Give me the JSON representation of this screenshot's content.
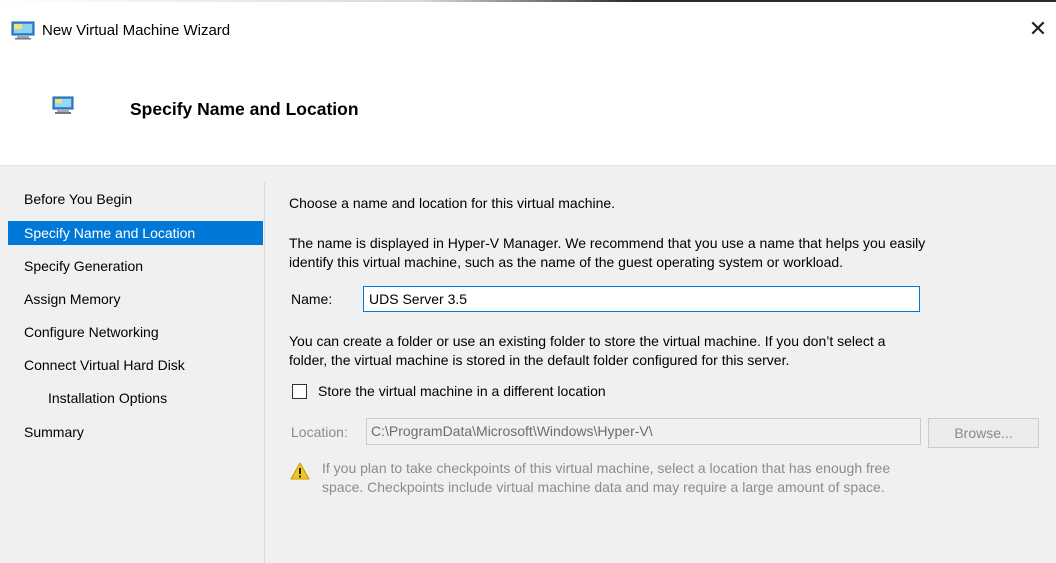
{
  "window": {
    "title": "New Virtual Machine Wizard",
    "close_glyph": "✕"
  },
  "header": {
    "page_title": "Specify Name and Location"
  },
  "sidebar": {
    "items": [
      {
        "label": "Before You Begin",
        "active": false
      },
      {
        "label": "Specify Name and Location",
        "active": true
      },
      {
        "label": "Specify Generation",
        "active": false
      },
      {
        "label": "Assign Memory",
        "active": false
      },
      {
        "label": "Configure Networking",
        "active": false
      },
      {
        "label": "Connect Virtual Hard Disk",
        "active": false
      },
      {
        "label": "Installation Options",
        "active": false
      },
      {
        "label": "Summary",
        "active": false
      }
    ]
  },
  "main": {
    "intro": "Choose a name and location for this virtual machine.",
    "name_help_line1": "The name is displayed in Hyper-V Manager. We recommend that you use a name that helps you easily",
    "name_help_line2": "identify this virtual machine, such as the name of the guest operating system or workload.",
    "name_label": "Name:",
    "name_value": "UDS Server 3.5",
    "folder_help_line1": "You can create a folder or use an existing folder to store the virtual machine. If you don’t select a",
    "folder_help_line2": "folder, the virtual machine is stored in the default folder configured for this server.",
    "store_checkbox_label": "Store the virtual machine in a different location",
    "store_checkbox_checked": false,
    "location_label": "Location:",
    "location_value": "C:\\ProgramData\\Microsoft\\Windows\\Hyper-V\\",
    "browse_label": "Browse...",
    "warning_line1": "If you plan to take checkpoints of this virtual machine, select a location that has enough free",
    "warning_line2": "space. Checkpoints include virtual machine data and may require a large amount of space."
  },
  "colors": {
    "accent": "#0078d7",
    "content_bg": "#f0f0f0",
    "disabled_text": "#8c8c8c",
    "warning": "#e6b800"
  },
  "icons": {
    "window_icon": "virtual-machine-icon",
    "header_icon": "virtual-machine-icon",
    "warning_icon": "warning-triangle-icon"
  }
}
